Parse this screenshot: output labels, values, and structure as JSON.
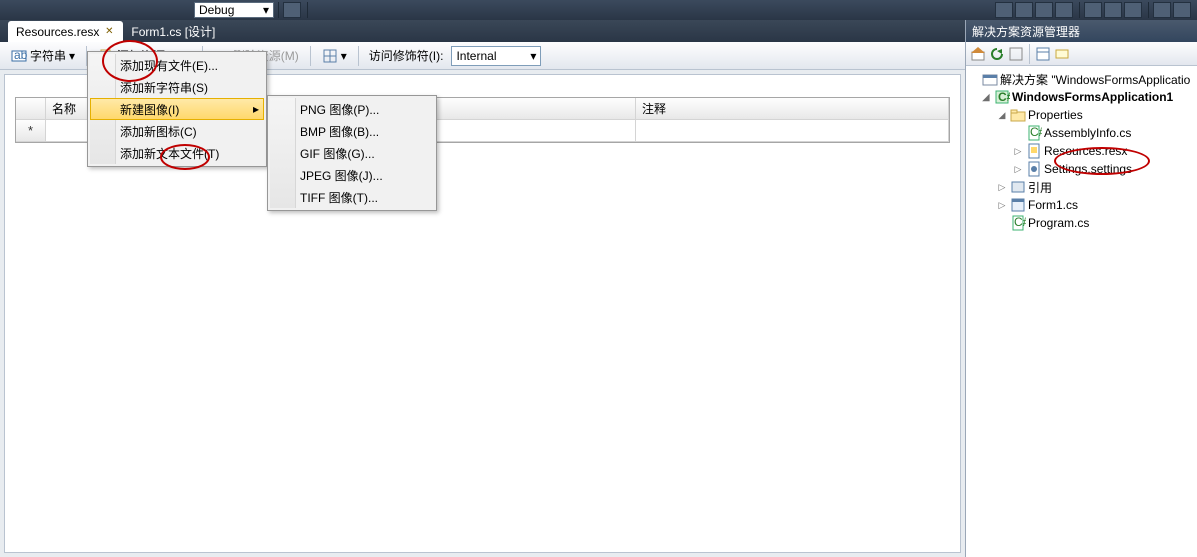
{
  "topDebug": "Debug",
  "tabs": {
    "active": "Resources.resx",
    "inactive": "Form1.cs [设计]"
  },
  "toolbar": {
    "strings_label": "字符串",
    "add_label": "添加资源(R)",
    "remove_label": "删除资源(M)",
    "access_label": "访问修饰符(I):",
    "access_value": "Internal"
  },
  "grid": {
    "col_name": "名称",
    "col_comment": "注释"
  },
  "menu1": {
    "items": [
      "添加现有文件(E)...",
      "添加新字符串(S)",
      "新建图像(I)",
      "添加新图标(C)",
      "添加新文本文件(T)"
    ]
  },
  "menu2": {
    "items": [
      "PNG 图像(P)...",
      "BMP 图像(B)...",
      "GIF 图像(G)...",
      "JPEG 图像(J)...",
      "TIFF 图像(T)..."
    ]
  },
  "solution": {
    "panel_title": "解决方案资源管理器",
    "root": "解决方案 \"WindowsFormsApplicatio",
    "project": "WindowsFormsApplication1",
    "properties": "Properties",
    "assembly": "AssemblyInfo.cs",
    "resources": "Resources.resx",
    "settings": "Settings.settings",
    "references": "引用",
    "form": "Form1.cs",
    "program": "Program.cs"
  }
}
